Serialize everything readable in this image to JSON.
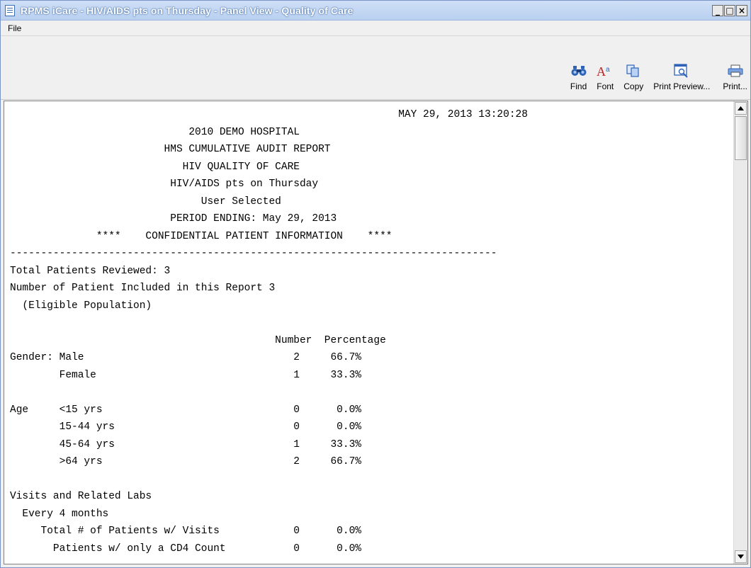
{
  "window": {
    "title": "RPMS iCare - HIV/AIDS pts on Thursday - Panel View - Quality of Care",
    "controls": {
      "minimize": "_",
      "maximize": "□",
      "close": "×"
    }
  },
  "menu": {
    "items": [
      {
        "label": "File"
      }
    ]
  },
  "toolbar": {
    "find_label": "Find",
    "font_label": "Font",
    "copy_label": "Copy",
    "preview_label": "Print Preview...",
    "print_label": "Print...",
    "icons": {
      "find": "binoculars-icon",
      "font": "font-icon",
      "copy": "copy-icon",
      "preview": "print-preview-icon",
      "print": "printer-icon"
    },
    "icon_colors": {
      "accent_blue": "#2f63b7",
      "accent_red": "#c02020"
    }
  },
  "report": {
    "lines": [
      "                                                               MAY 29, 2013 13:20:28",
      "                             2010 DEMO HOSPITAL",
      "                         HMS CUMULATIVE AUDIT REPORT",
      "                            HIV QUALITY OF CARE",
      "                          HIV/AIDS pts on Thursday",
      "                               User Selected",
      "                          PERIOD ENDING: May 29, 2013",
      "              ****    CONFIDENTIAL PATIENT INFORMATION    ****",
      "-------------------------------------------------------------------------------",
      "Total Patients Reviewed: 3",
      "Number of Patient Included in this Report 3",
      "  (Eligible Population)",
      "",
      "                                           Number  Percentage",
      "Gender: Male                                  2     66.7%",
      "        Female                                1     33.3%",
      "",
      "Age     <15 yrs                               0      0.0%",
      "        15-44 yrs                             0      0.0%",
      "        45-64 yrs                             1     33.3%",
      "        >64 yrs                               2     66.7%",
      "",
      "Visits and Related Labs",
      "  Every 4 months",
      "     Total # of Patients w/ Visits            0      0.0%",
      "       Patients w/ only a CD4 Count           0      0.0%"
    ]
  }
}
